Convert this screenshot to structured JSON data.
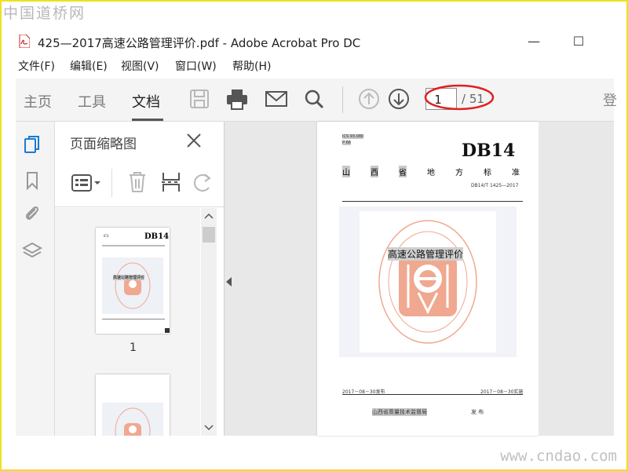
{
  "watermark": {
    "top": "中国道桥网",
    "bottom": "www.cndao.com"
  },
  "window": {
    "title": "425—2017高速公路管理评价.pdf - Adobe Acrobat Pro DC",
    "minimize": "—",
    "maximize": "☐"
  },
  "menu": [
    "文件(F)",
    "编辑(E)",
    "视图(V)",
    "窗口(W)",
    "帮助(H)"
  ],
  "tabs": {
    "home": "主页",
    "tools": "工具",
    "document": "文档",
    "active": "文档"
  },
  "toolbar": {
    "page_current": "1",
    "page_total": "/ 51",
    "signin_cut": "登",
    "annotation_color": "#e02020"
  },
  "sidebar": {
    "icons": [
      "pages-icon",
      "bookmark-icon",
      "attachment-icon",
      "layers-icon"
    ]
  },
  "thumbnail_panel": {
    "title": "页面缩略图",
    "page_label": "1",
    "thumb_db": "DB14"
  },
  "document": {
    "ics": "ICS  93.080",
    "class_code": "P 66",
    "db_code": "DB14",
    "province_standard": [
      "山",
      "西",
      "省",
      "地",
      "方",
      "标",
      "准"
    ],
    "standard_no": "DB14/T 1425—2017",
    "title": "高速公路管理评价",
    "issue_date": "2017－08－30发布",
    "impl_date": "2017－08－30实施",
    "issuer": "山西省质量技术监督局",
    "issue_word": "发 布"
  },
  "colors": {
    "accent": "#e02020",
    "seal": "#f0a890",
    "frame": "#f0e020"
  }
}
